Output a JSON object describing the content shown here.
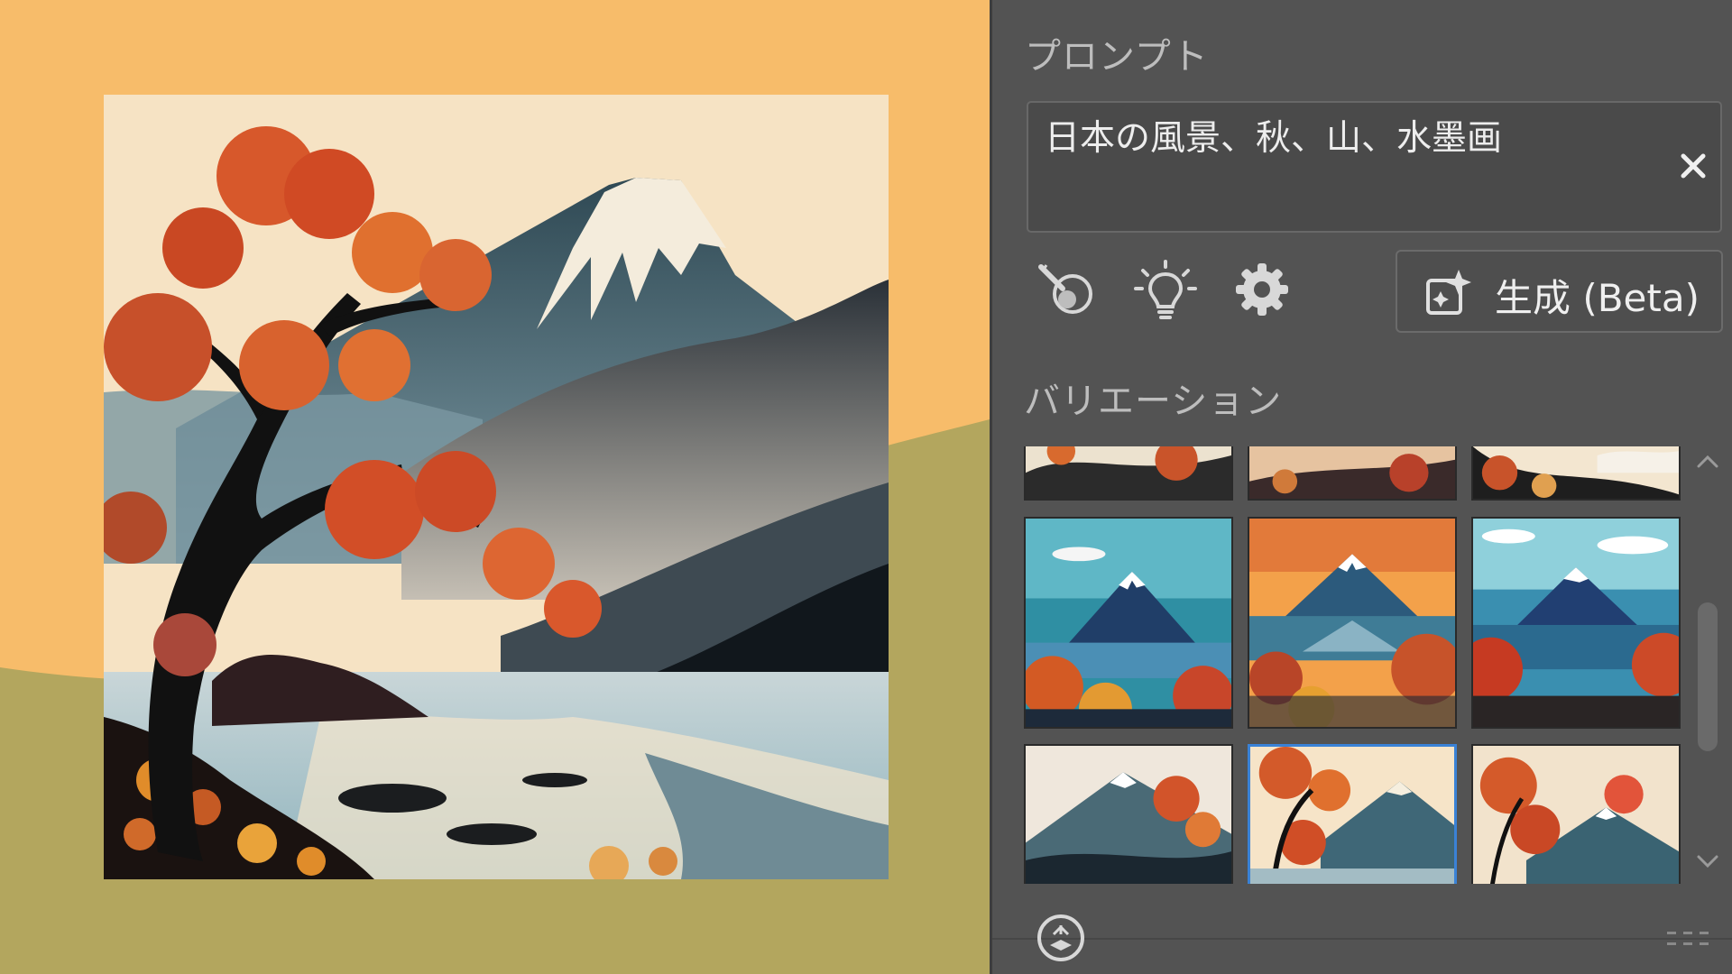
{
  "colors": {
    "canvas_orange": "#f7bc6a",
    "canvas_olive": "#b3a65e",
    "panel_bg": "#535353",
    "selected_border": "#3a82d6",
    "autumn_red": "#d0512a",
    "mountain_blue": "#3d6878"
  },
  "canvas": {
    "artwork": {
      "subject": "Mount Fuji with autumn maple tree, lake and hills in ink-wash style"
    }
  },
  "panel": {
    "prompt_title": "プロンプト",
    "prompt_value": "日本の風景、秋、山、水墨画",
    "clear_icon": "close-icon",
    "tools": [
      {
        "icon": "style-reference-icon"
      },
      {
        "icon": "lightbulb-icon"
      },
      {
        "icon": "gear-icon"
      }
    ],
    "generate_label": "生成 (Beta)",
    "generate_icon": "sparkle-frame-icon",
    "variations_title": "バリエーション",
    "gallery": {
      "selected_index": 7,
      "thumbnails": [
        {
          "theme": "cream-ink"
        },
        {
          "theme": "dusk"
        },
        {
          "theme": "cream-dark"
        },
        {
          "theme": "teal-sky"
        },
        {
          "theme": "orange-sky"
        },
        {
          "theme": "blue-sky"
        },
        {
          "theme": "cream-ink"
        },
        {
          "theme": "cream-tree"
        },
        {
          "theme": "cream-sun"
        }
      ]
    },
    "footer_icon": "layers-icon",
    "grip_icon": "resize-grip-icon"
  }
}
